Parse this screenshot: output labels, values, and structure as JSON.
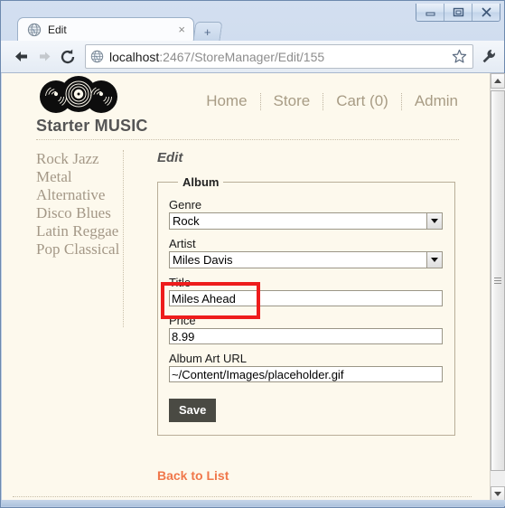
{
  "browser": {
    "tab": {
      "title": "Edit",
      "favicon": "globe-icon",
      "close_label": "×"
    },
    "new_tab_label": "+",
    "window_controls": {
      "minimize": "minimize-icon",
      "maximize": "maximize-icon",
      "close": "close-icon"
    },
    "toolbar": {
      "back": "back-arrow-icon",
      "forward": "forward-arrow-icon",
      "reload": "reload-icon",
      "bookmark": "star-icon",
      "menu": "wrench-icon"
    },
    "address_bar": {
      "favicon": "globe-icon",
      "url_host": "localhost",
      "url_path": ":2467/StoreManager/Edit/155",
      "full_url": "localhost:2467/StoreManager/Edit/155"
    }
  },
  "site": {
    "logo": "vinyl-records-logo",
    "title": "Starter MUSIC",
    "nav": [
      {
        "label": "Home"
      },
      {
        "label": "Store"
      },
      {
        "label": "Cart (0)"
      },
      {
        "label": "Admin"
      }
    ]
  },
  "sidebar": {
    "genres": [
      {
        "label": "Rock"
      },
      {
        "label": "Jazz"
      },
      {
        "label": "Metal"
      },
      {
        "label": "Alternative"
      },
      {
        "label": "Disco"
      },
      {
        "label": "Blues"
      },
      {
        "label": "Latin"
      },
      {
        "label": "Reggae"
      },
      {
        "label": "Pop"
      },
      {
        "label": "Classical"
      }
    ]
  },
  "main": {
    "heading": "Edit",
    "fieldset_legend": "Album",
    "fields": {
      "genre": {
        "label": "Genre",
        "value": "Rock"
      },
      "artist": {
        "label": "Artist",
        "value": "Miles Davis"
      },
      "title": {
        "label": "Title",
        "value": "Miles Ahead"
      },
      "price": {
        "label": "Price",
        "value": "8.99"
      },
      "album_art_url": {
        "label": "Album Art URL",
        "value": "~/Content/Images/placeholder.gif"
      }
    },
    "save_label": "Save",
    "back_link": "Back to List"
  },
  "annotation": {
    "highlight_target": "genre-field",
    "color": "#ee1c1c"
  },
  "scrollbar": {
    "up": "scroll-up-arrow",
    "down": "scroll-down-arrow",
    "thumb": "scroll-thumb"
  }
}
